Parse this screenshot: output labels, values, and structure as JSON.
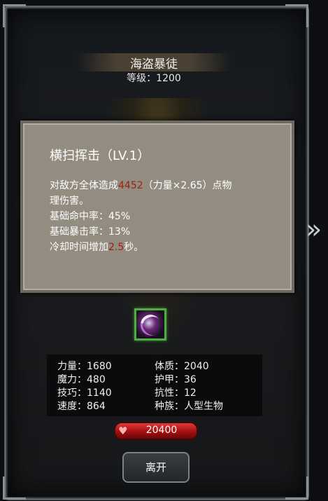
{
  "header": {
    "title": "海盗暴徒",
    "level": "等级：1200"
  },
  "skill": {
    "name": "横扫挥击（LV.1）",
    "desc1_prefix": "对敌方全体造成",
    "damage_value": "4452",
    "desc1_suffix": "（力量×2.65）点物",
    "desc2": "理伤害。",
    "hit_rate": "基础命中率：45%",
    "crit_rate": "基础暴击率：13%",
    "cd_prefix": "冷却时间增加",
    "cd_value": "2.5",
    "cd_suffix": "秒。"
  },
  "stats": {
    "strength": "力量：1680",
    "constitution": "体质：2040",
    "magic": "魔力：480",
    "armor": "护甲：36",
    "skill_stat": "技巧：1140",
    "resistance": "抗性：12",
    "speed": "速度：864",
    "race": "种族：人型生物"
  },
  "hp": {
    "value": "20400"
  },
  "buttons": {
    "leave": "离开",
    "next": "»"
  },
  "colors": {
    "highlight": "#9c1f12",
    "icon_border": "#4cae3c",
    "hp_red": "#c21818"
  },
  "icons": {
    "skill": "purple-slash-skill-icon",
    "heart": "heart-icon"
  }
}
